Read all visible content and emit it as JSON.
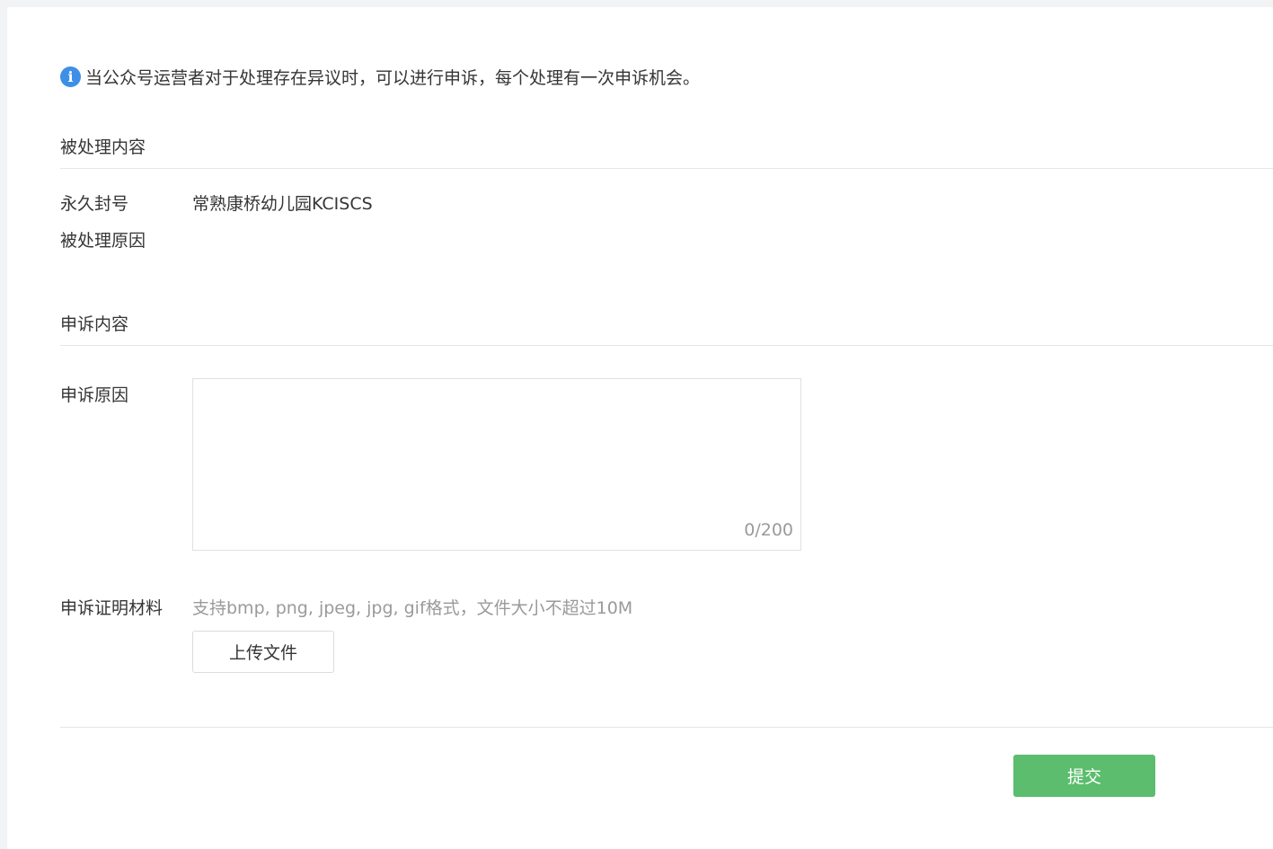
{
  "notice": {
    "icon": "info-icon",
    "text": "当公众号运营者对于处理存在异议时，可以进行申诉，每个处理有一次申诉机会。"
  },
  "processed_section": {
    "title": "被处理内容",
    "action_label": "永久封号",
    "account_name": "常熟康桥幼儿园KCISCS",
    "reason_label": "被处理原因"
  },
  "appeal_section": {
    "title": "申诉内容",
    "reason_label": "申诉原因",
    "reason_value": "",
    "reason_counter": "0/200",
    "evidence_label": "申诉证明材料",
    "evidence_hint": "支持bmp, png, jpeg, jpg, gif格式，文件大小不超过10M",
    "upload_button": "上传文件"
  },
  "footer": {
    "submit_button": "提交"
  },
  "colors": {
    "accent": "#5bbd6d",
    "info_icon": "#3e8fe6",
    "hint_text": "#9a9a9a"
  }
}
